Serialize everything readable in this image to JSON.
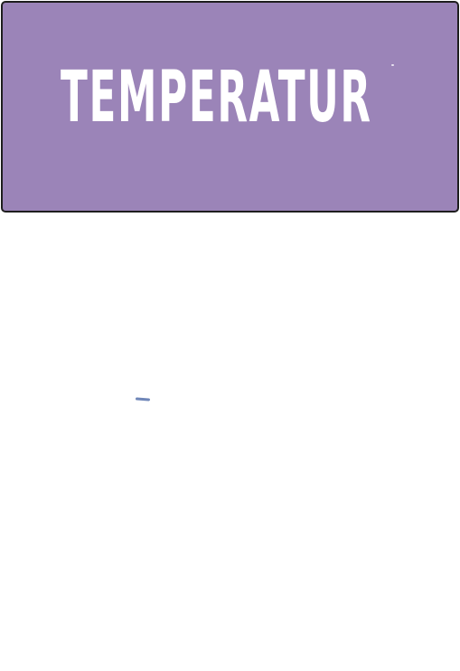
{
  "banner": {
    "title": "TEMPERATUR",
    "background_color": "#9b84b8",
    "border_color": "#1e1e1e",
    "text_color": "#ffffff"
  },
  "canvas": {
    "background_color": "#ffffff",
    "stroke_color": "#6f86b8"
  }
}
